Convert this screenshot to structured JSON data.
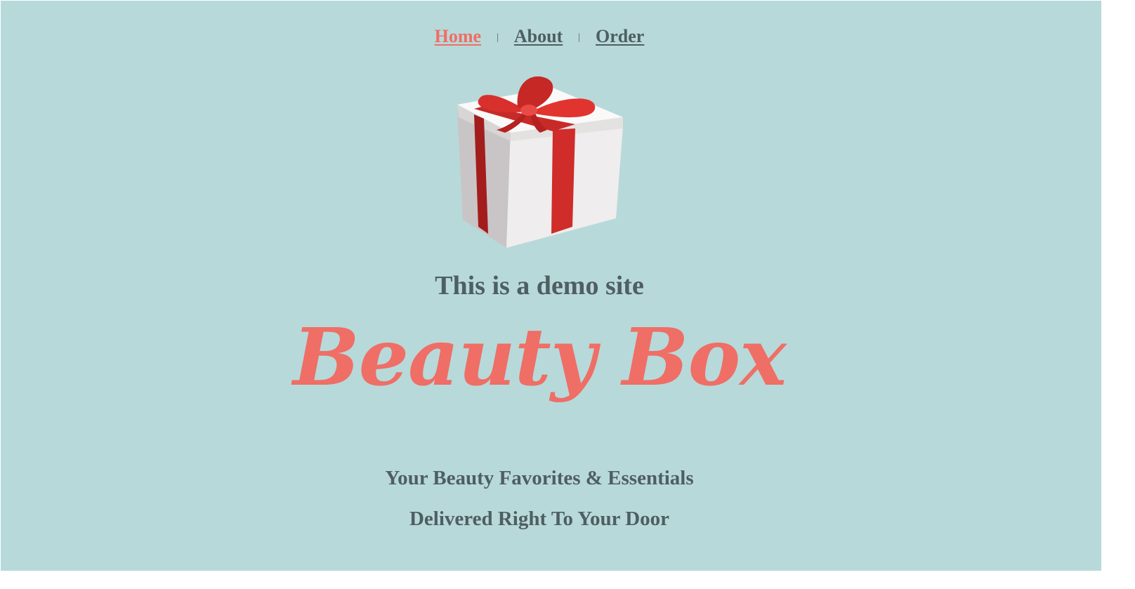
{
  "nav": {
    "items": [
      {
        "label": "Home",
        "active": true
      },
      {
        "label": "About",
        "active": false
      },
      {
        "label": "Order",
        "active": false
      }
    ],
    "separator": "|"
  },
  "hero": {
    "image": "gift-box-icon",
    "demo_text": "This is a demo site",
    "brand_name": "Beauty Box",
    "tagline_line1": "Your Beauty Favorites & Essentials",
    "tagline_line2": "Delivered Right To Your Door"
  },
  "colors": {
    "background": "#b8d9d9",
    "accent": "#ef6e66",
    "text": "#4e5e63",
    "ribbon": "#d22f2c",
    "box": "#f1eeee"
  }
}
